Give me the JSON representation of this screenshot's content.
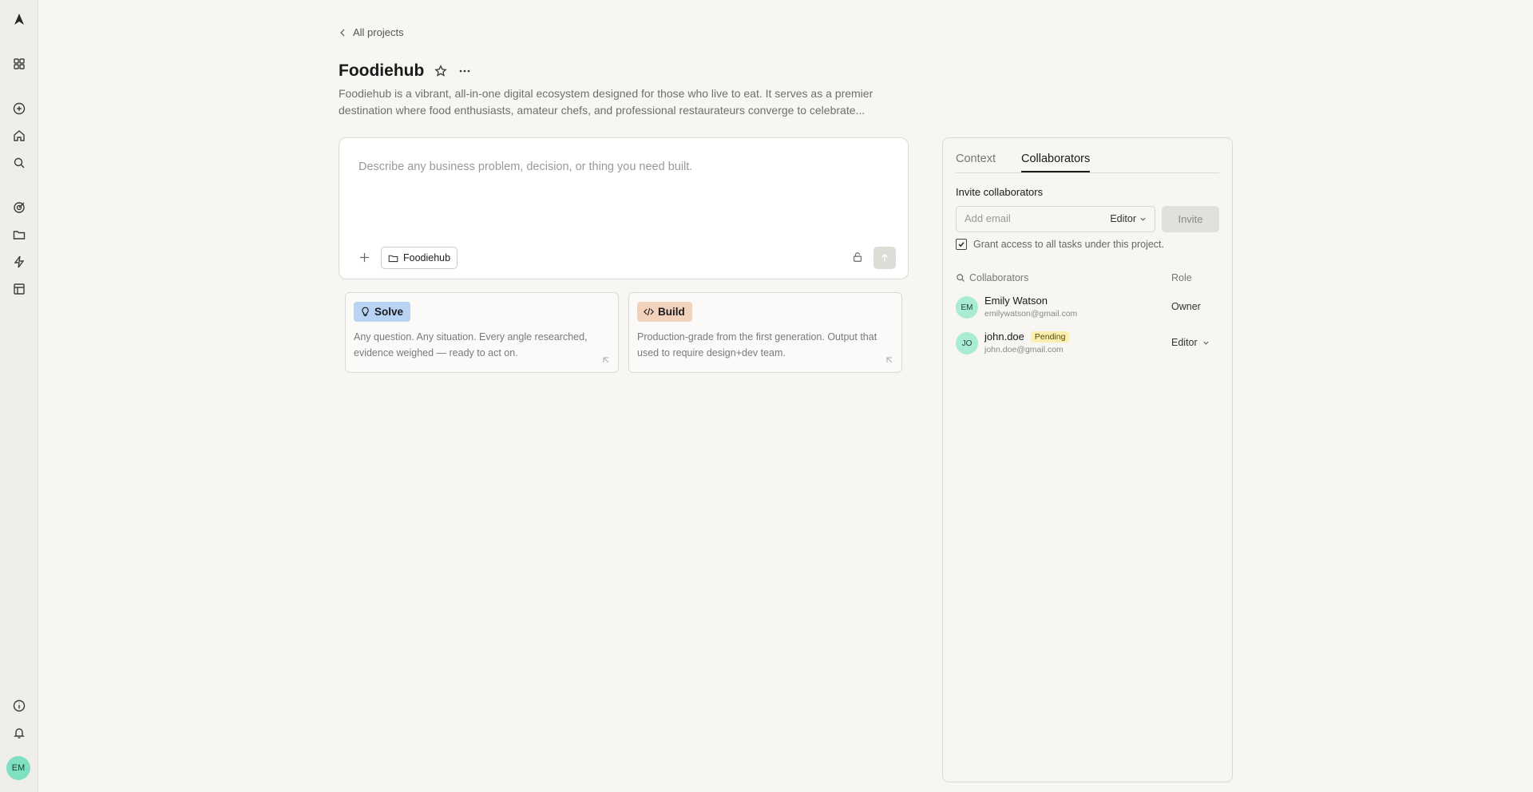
{
  "sidebar": {
    "icons": [
      {
        "name": "logo-icon"
      },
      {
        "name": "apps-grid-icon"
      },
      {
        "name": "new-task-icon"
      },
      {
        "name": "home-icon"
      },
      {
        "name": "search-icon"
      },
      {
        "name": "target-icon"
      },
      {
        "name": "folder-icon"
      },
      {
        "name": "lightning-icon"
      },
      {
        "name": "layout-icon"
      },
      {
        "name": "info-icon"
      },
      {
        "name": "bell-icon"
      }
    ],
    "avatar_initials": "EM"
  },
  "header": {
    "back_label": "All projects",
    "title": "Foodiehub",
    "description": "Foodiehub is a vibrant, all-in-one digital ecosystem designed for those who live to eat. It serves as a premier destination where food enthusiasts, amateur chefs, and professional restaurateurs converge to celebrate..."
  },
  "prompt": {
    "placeholder": "Describe any business problem, decision, or thing you need built.",
    "project_chip": "Foodiehub"
  },
  "cards": [
    {
      "label": "Solve",
      "icon": "lightbulb-icon",
      "color": "#b9d3f5",
      "description": "Any question. Any situation. Every angle researched, evidence weighed — ready to act on."
    },
    {
      "label": "Build",
      "icon": "code-icon",
      "color": "#f2d2bd",
      "description": "Production-grade from the first generation. Output that used to require design+dev team."
    }
  ],
  "panel": {
    "tabs": [
      {
        "label": "Context",
        "active": false
      },
      {
        "label": "Collaborators",
        "active": true
      }
    ],
    "invite_heading": "Invite collaborators",
    "email_placeholder": "Add email",
    "default_role": "Editor",
    "invite_button": "Invite",
    "grant_label": "Grant access to all tasks under this project.",
    "grant_checked": true,
    "list_header": "Collaborators",
    "role_header": "Role",
    "collaborators": [
      {
        "initials": "EM",
        "name": "Emily Watson",
        "email": "emilywatson@gmail.com",
        "role": "Owner",
        "pending": ""
      },
      {
        "initials": "JO",
        "name": "john.doe",
        "email": "john.doe@gmail.com",
        "role": "Editor",
        "pending": "Pending"
      }
    ]
  }
}
